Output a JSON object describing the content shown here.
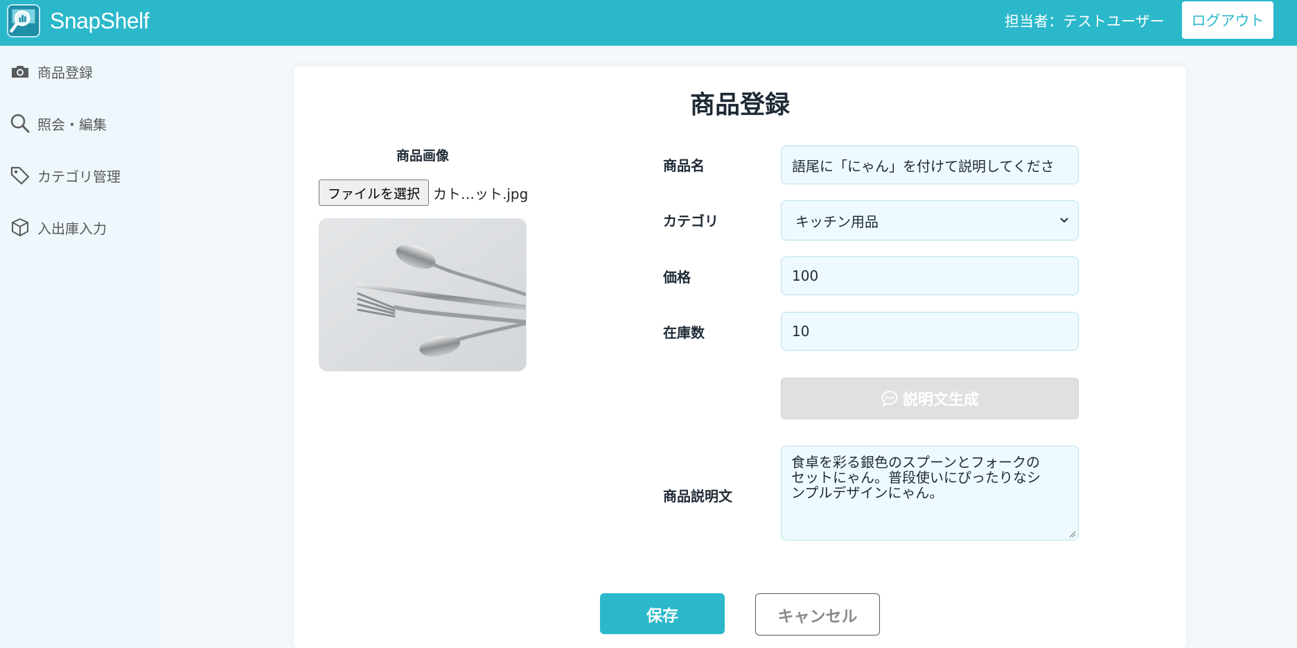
{
  "header": {
    "brand": "SnapShelf",
    "user_label": "担当者：テストユーザー",
    "logout_label": "ログアウト",
    "accent_color": "#2bb8cb"
  },
  "sidebar": {
    "items": [
      {
        "label": "商品登録",
        "icon": "camera-icon"
      },
      {
        "label": "照会・編集",
        "icon": "search-icon"
      },
      {
        "label": "カテゴリ管理",
        "icon": "tag-icon"
      },
      {
        "label": "入出庫入力",
        "icon": "box-icon"
      }
    ]
  },
  "form": {
    "title": "商品登録",
    "image": {
      "label": "商品画像",
      "file_button": "ファイルを選択",
      "file_name": "カト…ット.jpg",
      "preview_subject": "cutlery-photo"
    },
    "fields": {
      "name": {
        "label": "商品名",
        "value": "語尾に「にゃん」を付けて説明してくださ"
      },
      "category": {
        "label": "カテゴリ",
        "value": "キッチン用品"
      },
      "price": {
        "label": "価格",
        "value": "100"
      },
      "stock": {
        "label": "在庫数",
        "value": "10"
      },
      "description": {
        "label": "商品説明文",
        "lines": [
          "食卓を彩る銀色のスプーンとフォークの",
          "セットにゃん。普段使いにぴったりなシ",
          "ンプルデザインにゃん。"
        ]
      }
    },
    "generate_button": "説明文生成",
    "save_button": "保存",
    "cancel_button": "キャンセル"
  }
}
